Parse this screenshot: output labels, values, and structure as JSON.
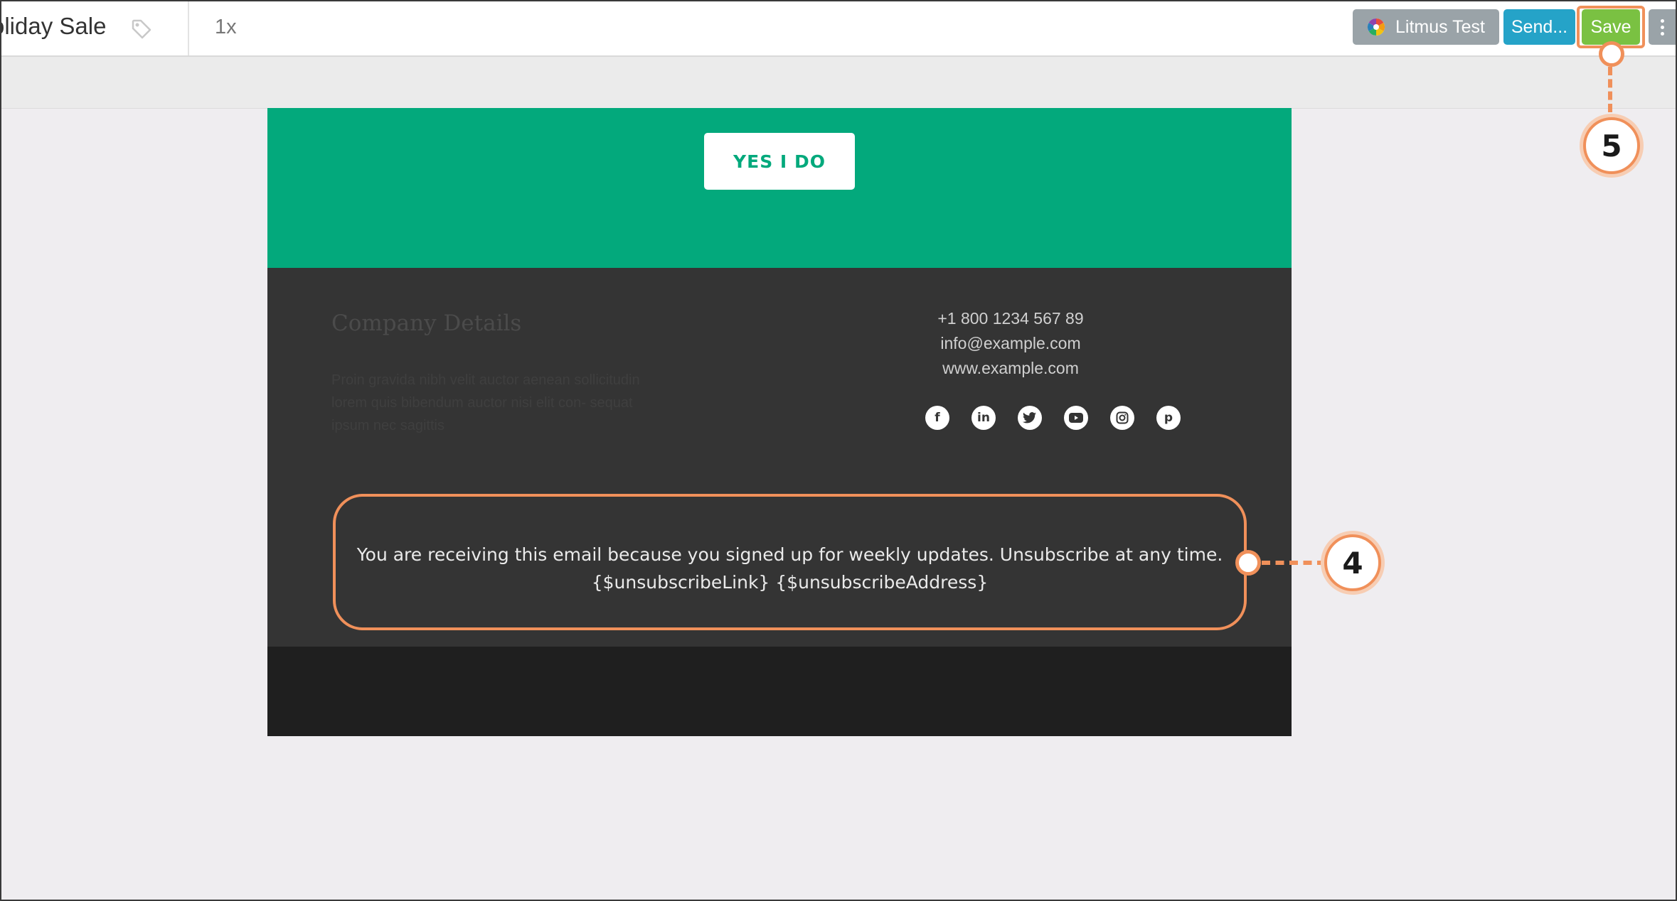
{
  "toolbar": {
    "title": "oliday Sale",
    "zoom": "1x",
    "litmus_label": "Litmus Test",
    "send_label": "Send...",
    "save_label": "Save"
  },
  "email": {
    "cta_label": "YES I DO",
    "company_title": "Company Details",
    "company_text": "Proin gravida nibh velit auctor aenean sollicitudin lorem quis bibendum auctor nisi elit con- sequat ipsum nec sagittis",
    "phone": "+1 800 1234 567 89",
    "email": "info@example.com",
    "website": "www.example.com",
    "social_icons": [
      "facebook-icon",
      "linkedin-icon",
      "twitter-icon",
      "youtube-icon",
      "instagram-icon",
      "pinterest-icon"
    ],
    "unsubscribe_line1": "You are receiving this email because you signed up for weekly updates. Unsubscribe at any time.",
    "unsubscribe_line2": "{$unsubscribeLink} {$unsubscribeAddress}"
  },
  "callouts": {
    "four": "4",
    "five": "5"
  },
  "colors": {
    "green": "#03a97c",
    "footer_dark": "#343434",
    "save_green": "#7ac142",
    "send_blue": "#25a3c8",
    "callout_orange": "#f0905a"
  }
}
